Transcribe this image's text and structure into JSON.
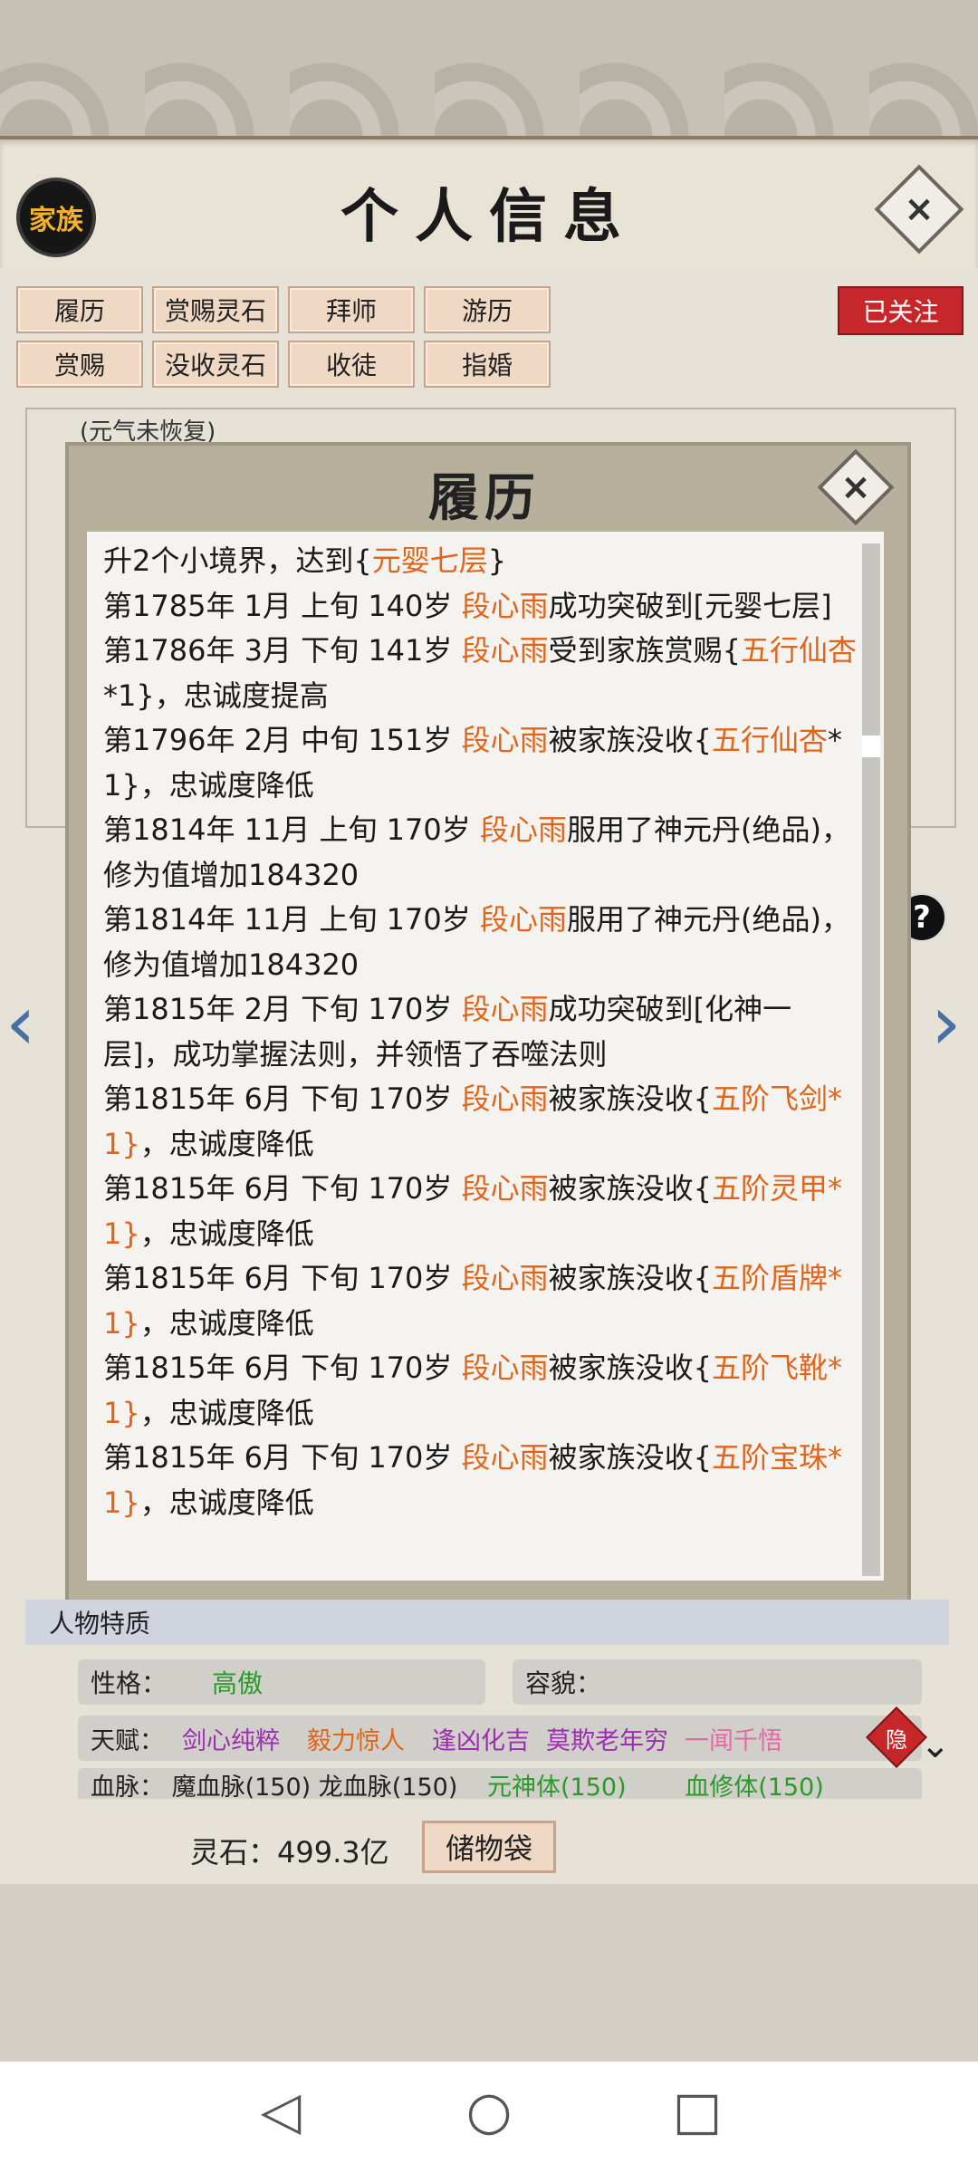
{
  "header": {
    "title": "个人信息",
    "clan_button": "家族",
    "close_icon": "×"
  },
  "tabs_row1": [
    "履历",
    "赏赐灵石",
    "拜师",
    "游历"
  ],
  "tabs_row2": [
    "赏赐",
    "没收灵石",
    "收徒",
    "指婚"
  ],
  "followed_badge": "已关注",
  "behind": {
    "status_note": "(元气未恢复)"
  },
  "modal": {
    "title": "履历",
    "close_icon": "×",
    "lines": [
      {
        "pre": "升2个小境界，达到{",
        "hl": "元婴七层",
        "post": "}"
      },
      {
        "pre": "第1785年 1月 上旬  140岁  ",
        "hl": "段心雨",
        "post": "成功突破到[元婴七层]"
      },
      {
        "pre": "第1786年 3月 下旬  141岁  ",
        "hl": "段心雨",
        "post": "受到家族赏赐{",
        "hl2": "五行仙杏",
        "post2": "*1}，忠诚度提高"
      },
      {
        "pre": "第1796年 2月 中旬  151岁  ",
        "hl": "段心雨",
        "post": "被家族没收{",
        "hl2": "五行仙杏",
        "post2": "*1}，忠诚度降低"
      },
      {
        "pre": "第1814年 11月 上旬  170岁  ",
        "hl": "段心雨",
        "post": "服用了神元丹(绝品)，修为值增加184320"
      },
      {
        "pre": "第1814年 11月 上旬  170岁  ",
        "hl": "段心雨",
        "post": "服用了神元丹(绝品)，修为值增加184320"
      },
      {
        "pre": "第1815年 2月 下旬  170岁  ",
        "hl": "段心雨",
        "post": "成功突破到[化神一层]，成功掌握法则，并领悟了吞噬法则"
      },
      {
        "pre": "第1815年 6月 下旬  170岁  ",
        "hl": "段心雨",
        "post": "被家族没收{",
        "hl2": "五阶飞剑*1}",
        "post2": "，忠诚度降低"
      },
      {
        "pre": "第1815年 6月 下旬  170岁  ",
        "hl": "段心雨",
        "post": "被家族没收{",
        "hl2": "五阶灵甲*1}",
        "post2": "，忠诚度降低"
      },
      {
        "pre": "第1815年 6月 下旬  170岁  ",
        "hl": "段心雨",
        "post": "被家族没收{",
        "hl2": "五阶盾牌*1}",
        "post2": "，忠诚度降低"
      },
      {
        "pre": "第1815年 6月 下旬  170岁  ",
        "hl": "段心雨",
        "post": "被家族没收{",
        "hl2": "五阶飞靴*1}",
        "post2": "，忠诚度降低"
      },
      {
        "pre": "第1815年 6月 下旬  170岁  ",
        "hl": "段心雨",
        "post": "被家族没收{",
        "hl2": "五阶宝珠*1}",
        "post2": "，忠诚度降低"
      }
    ]
  },
  "traits": {
    "header": "人物特质",
    "personality_label": "性格：",
    "personality_value": "高傲",
    "appearance_label": "容貌：",
    "talent_label": "天赋：",
    "talents": [
      "剑心纯粹",
      "毅力惊人",
      "逢凶化吉",
      "莫欺老年穷",
      "一闻千悟"
    ],
    "hide_badge": "隐",
    "bloodline_label": "血脉：",
    "bloodlines": [
      "魔血脉(150)",
      "龙血脉(150)",
      "元神体(150)",
      "血修体(150)"
    ]
  },
  "footer": {
    "stone_label": "灵石：499.3亿",
    "bag_button": "储物袋"
  },
  "colors": {
    "highlight": "#e0651a",
    "followed": "#c5272b",
    "panel": "#e6e2d8"
  }
}
